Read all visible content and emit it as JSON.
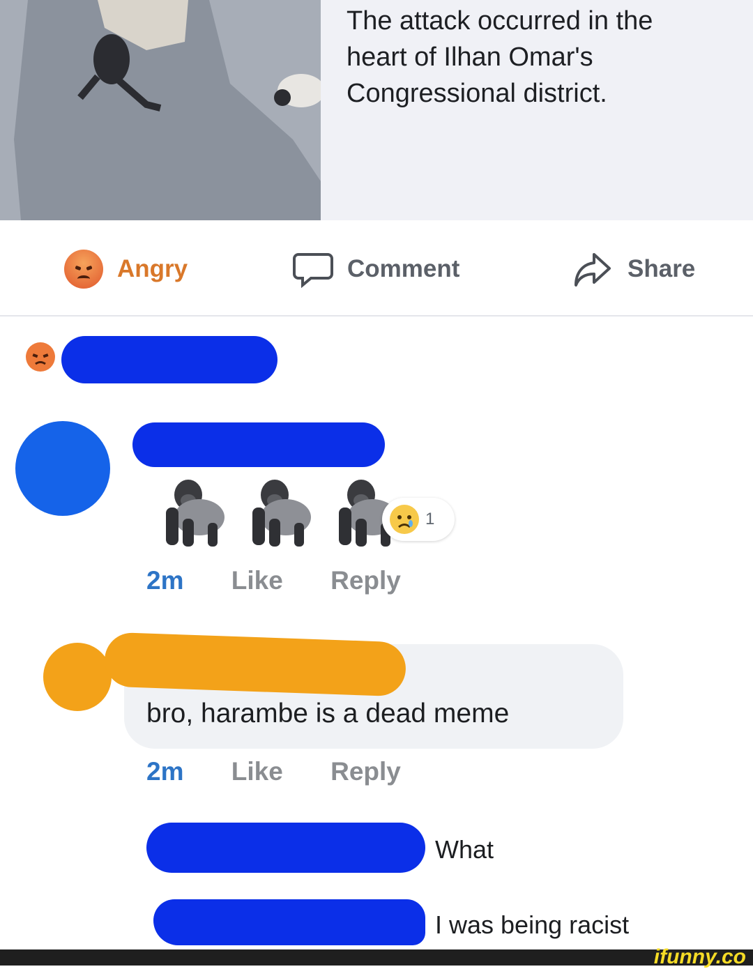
{
  "link_preview": {
    "headline_lines": [
      "The attack occurred in the",
      "heart of Ilhan Omar's",
      "Congressional district."
    ]
  },
  "action_bar": {
    "reaction_label": "Angry",
    "comment_label": "Comment",
    "share_label": "Share",
    "icons": [
      "angry-emoji-icon",
      "comment-bubble-icon",
      "share-arrow-icon"
    ],
    "colors": {
      "reaction": "#d9782a",
      "action": "#5b6068"
    }
  },
  "comments": [
    {
      "body_emoji": [
        "gorilla",
        "gorilla",
        "gorilla"
      ],
      "reaction_count": "1",
      "time": "2m",
      "like": "Like",
      "reply": "Reply"
    },
    {
      "text": "bro, harambe is a dead meme",
      "time": "2m",
      "like": "Like",
      "reply": "Reply"
    }
  ],
  "replies": [
    {
      "text": "What"
    },
    {
      "text": "I was being racist"
    }
  ],
  "watermark": "ifunny.co",
  "colors": {
    "redact_blue": "#0b2fe8",
    "redact_orange": "#f3a219",
    "time_blue": "#2d74c6"
  }
}
